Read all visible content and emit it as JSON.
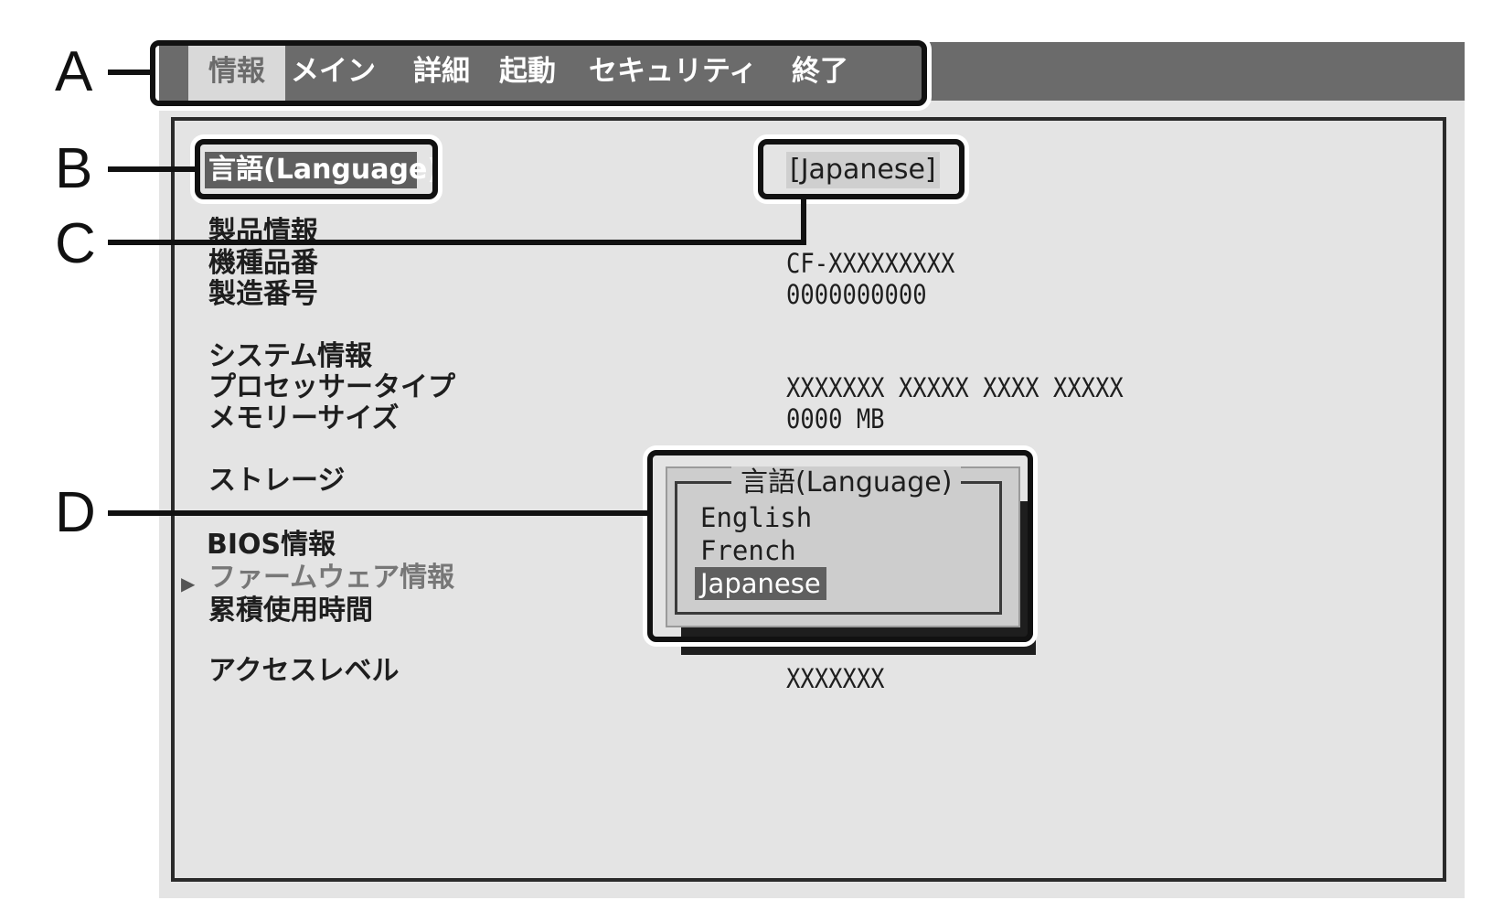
{
  "menu": {
    "tabs": [
      {
        "label": "情報",
        "active": true
      },
      {
        "label": "メイン",
        "active": false
      },
      {
        "label": "詳細",
        "active": false
      },
      {
        "label": "起動",
        "active": false
      },
      {
        "label": "セキュリティ",
        "active": false
      },
      {
        "label": "終了",
        "active": false
      }
    ]
  },
  "language": {
    "label": "言語(Language)",
    "value": "[Japanese]"
  },
  "product": {
    "heading": "製品情報",
    "model_label": "機種品番",
    "model_value": "CF-XXXXXXXXX",
    "serial_label": "製造番号",
    "serial_value": "0000000000"
  },
  "system": {
    "heading": "システム情報",
    "processor_label": "プロセッサータイプ",
    "processor_value": "XXXXXXX XXXXX XXXX XXXXX",
    "memory_label": "メモリーサイズ",
    "memory_value": "0000 MB"
  },
  "storage": {
    "label": "ストレージ"
  },
  "bios": {
    "heading": "BIOS情報",
    "firmware_label": "ファームウェア情報",
    "usage_label": "累積使用時間"
  },
  "access": {
    "label": "アクセスレベル",
    "value": "XXXXXXX"
  },
  "popup": {
    "title": "言語(Language)",
    "options": [
      "English",
      "French",
      "Japanese"
    ],
    "selected": "Japanese"
  },
  "callouts": [
    "A",
    "B",
    "C",
    "D"
  ],
  "colors": {
    "menubar": "#6b6b6b",
    "panel": "#e4e4e4",
    "highlight": "#5f5f5f"
  }
}
